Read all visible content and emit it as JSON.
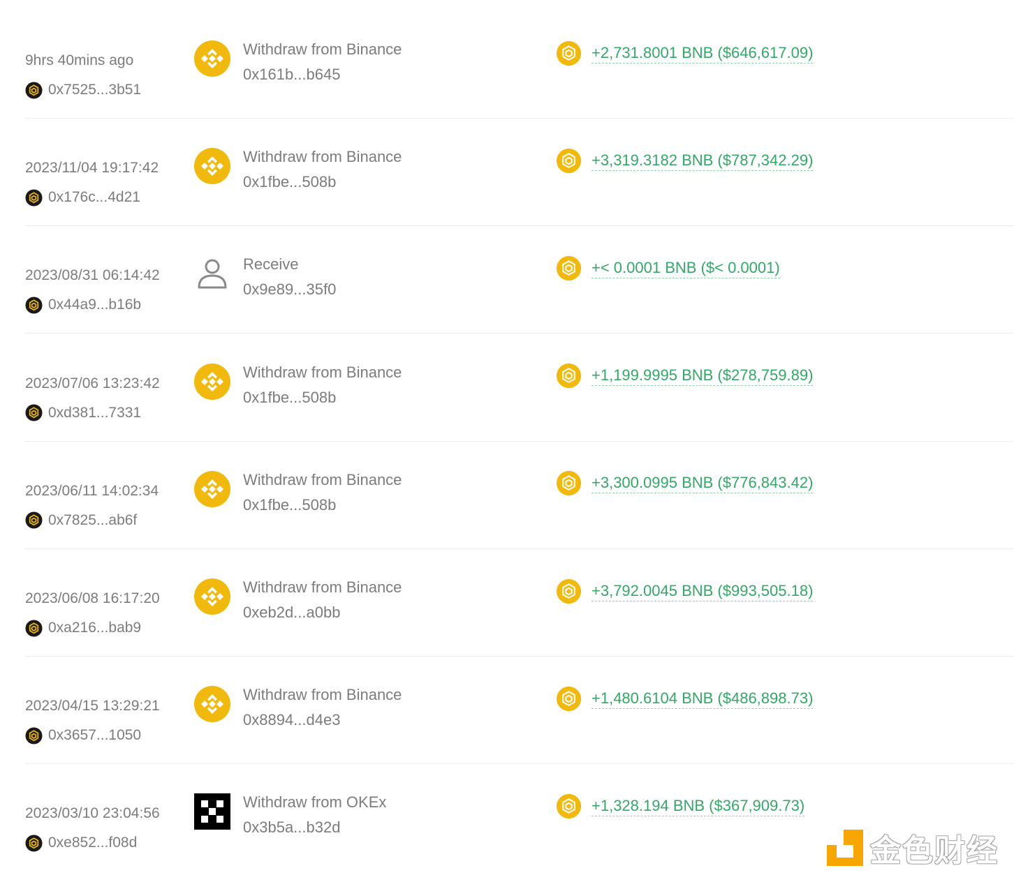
{
  "colors": {
    "amount_green": "#33a867",
    "binance_yellow": "#F0B90B",
    "text_gray": "#7c7c7c"
  },
  "transactions": [
    {
      "time": "9hrs 40mins ago",
      "hash": "0x7525...3b51",
      "type_icon": "binance-icon",
      "type_label": "Withdraw from Binance",
      "counterparty": "0x161b...b645",
      "amount": "+2,731.8001 BNB ($646,617.09)"
    },
    {
      "time": "2023/11/04 19:17:42",
      "hash": "0x176c...4d21",
      "type_icon": "binance-icon",
      "type_label": "Withdraw from Binance",
      "counterparty": "0x1fbe...508b",
      "amount": "+3,319.3182 BNB ($787,342.29)"
    },
    {
      "time": "2023/08/31 06:14:42",
      "hash": "0x44a9...b16b",
      "type_icon": "user-icon",
      "type_label": "Receive",
      "counterparty": "0x9e89...35f0",
      "amount": "+< 0.0001 BNB ($< 0.0001)"
    },
    {
      "time": "2023/07/06 13:23:42",
      "hash": "0xd381...7331",
      "type_icon": "binance-icon",
      "type_label": "Withdraw from Binance",
      "counterparty": "0x1fbe...508b",
      "amount": "+1,199.9995 BNB ($278,759.89)"
    },
    {
      "time": "2023/06/11 14:02:34",
      "hash": "0x7825...ab6f",
      "type_icon": "binance-icon",
      "type_label": "Withdraw from Binance",
      "counterparty": "0x1fbe...508b",
      "amount": "+3,300.0995 BNB ($776,843.42)"
    },
    {
      "time": "2023/06/08 16:17:20",
      "hash": "0xa216...bab9",
      "type_icon": "binance-icon",
      "type_label": "Withdraw from Binance",
      "counterparty": "0xeb2d...a0bb",
      "amount": "+3,792.0045 BNB ($993,505.18)"
    },
    {
      "time": "2023/04/15 13:29:21",
      "hash": "0x3657...1050",
      "type_icon": "binance-icon",
      "type_label": "Withdraw from Binance",
      "counterparty": "0x8894...d4e3",
      "amount": "+1,480.6104 BNB ($486,898.73)"
    },
    {
      "time": "2023/03/10 23:04:56",
      "hash": "0xe852...f08d",
      "type_icon": "okex-icon",
      "type_label": "Withdraw from OKEx",
      "counterparty": "0x3b5a...b32d",
      "amount": "+1,328.194 BNB ($367,909.73)"
    }
  ],
  "watermark": {
    "text": "金色财经"
  }
}
